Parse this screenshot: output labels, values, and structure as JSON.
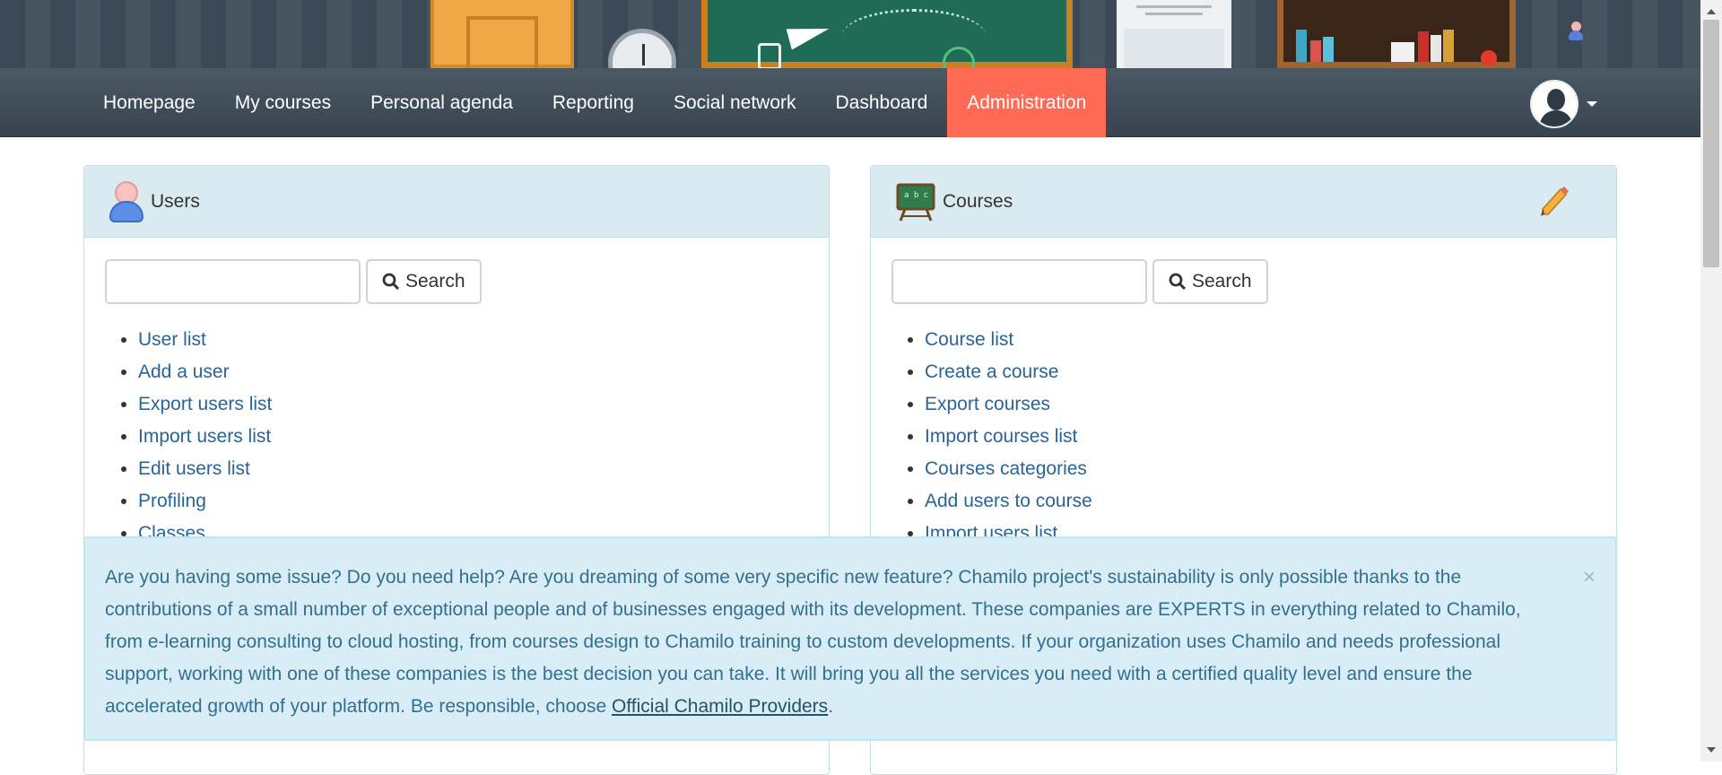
{
  "nav": {
    "items": [
      {
        "label": "Homepage"
      },
      {
        "label": "My courses"
      },
      {
        "label": "Personal agenda"
      },
      {
        "label": "Reporting"
      },
      {
        "label": "Social network"
      },
      {
        "label": "Dashboard"
      },
      {
        "label": "Administration",
        "active": true
      }
    ],
    "active_color": "#ff6a55"
  },
  "panels": {
    "users": {
      "title": "Users",
      "icon": "user-icon",
      "search_value": "",
      "search_button": "Search",
      "links": [
        "User list",
        "Add a user",
        "Export users list",
        "Import users list",
        "Edit users list",
        "Profiling",
        "Classes"
      ]
    },
    "courses": {
      "title": "Courses",
      "icon": "chalkboard-icon",
      "search_value": "",
      "search_button": "Search",
      "links": [
        "Course list",
        "Create a course",
        "Export courses",
        "Import courses list",
        "Courses categories",
        "Add users to course",
        "Import users list"
      ]
    }
  },
  "alert": {
    "text": "Are you having some issue? Do you need help? Are you dreaming of some very specific new feature? Chamilo project's sustainability is only possible thanks to the contributions of a small number of exceptional people and of businesses engaged with its development. These companies are EXPERTS in everything related to Chamilo, from e-learning consulting to cloud hosting, from courses design to Chamilo training to custom developments. If your organization uses Chamilo and needs professional support, working with one of these companies is the best decision you can take. It will bring you all the services you need with a certified quality level and ensure the accelerated growth of your platform. Be responsible, choose ",
    "link_text": "Official Chamilo Providers",
    "suffix": ".",
    "close": "×"
  }
}
